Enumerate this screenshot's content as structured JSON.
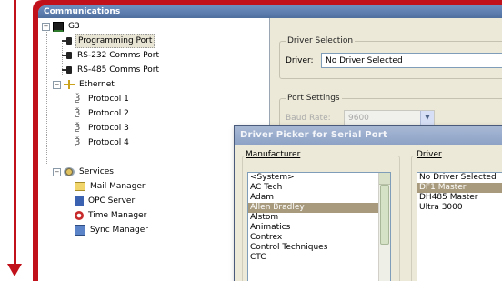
{
  "window": {
    "title": "Communications"
  },
  "tree": {
    "root": "G3",
    "ports": [
      "Programming Port",
      "RS-232 Comms Port",
      "RS-485 Comms Port"
    ],
    "ethernet": {
      "label": "Ethernet",
      "protocols": [
        "Protocol 1",
        "Protocol 2",
        "Protocol 3",
        "Protocol 4"
      ]
    },
    "services": {
      "label": "Services",
      "items": [
        "Mail Manager",
        "OPC Server",
        "Time Manager",
        "Sync Manager"
      ]
    },
    "icons": {
      "root": "controller-icon",
      "port": "serial-port-icon",
      "ethernet": "network-icon",
      "protocol": "protocol-icon",
      "services": "services-icon"
    }
  },
  "driver_selection": {
    "group_title": "Driver Selection",
    "driver_label": "Driver:",
    "driver_value": "No Driver Selected"
  },
  "port_settings": {
    "group_title": "Port Settings",
    "baud_label": "Baud Rate:",
    "baud_value": "9600"
  },
  "dialog": {
    "title": "Driver Picker for Serial Port",
    "manufacturer_label": "Manufacturer",
    "manufacturers": [
      "<System>",
      "AC Tech",
      "Adam",
      "Allen Bradley",
      "Alstom",
      "Animatics",
      "Contrex",
      "Control Techniques",
      "CTC"
    ],
    "selected_manufacturer": "Allen Bradley",
    "driver_label": "Driver",
    "drivers": [
      "No Driver Selected",
      "DF1 Master",
      "DH485 Master",
      "Ultra 3000"
    ],
    "selected_driver": "DF1 Master"
  },
  "colors": {
    "frame": "#c1111a",
    "selection": "#a89a7c",
    "titlebar": "#4f6f9f"
  }
}
